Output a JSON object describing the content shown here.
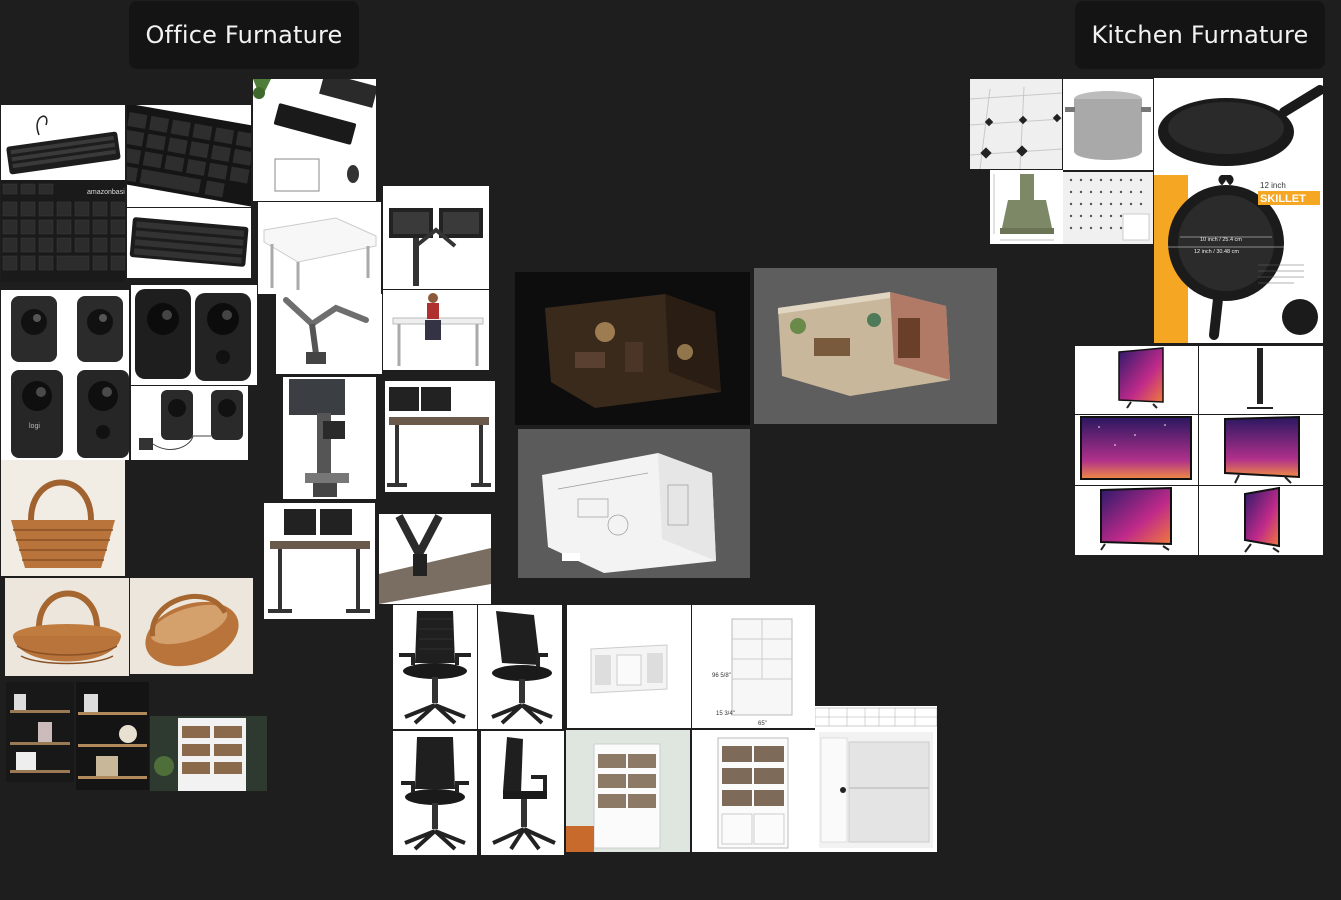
{
  "board": {
    "groups": [
      {
        "title": "Office Furnature"
      },
      {
        "title": "Kitchen Furnature"
      }
    ]
  },
  "tiles": {
    "keyboard_brand": "amazonbasics",
    "speaker_brand": "logi",
    "skillet": {
      "size_label": "12 inch",
      "name": "SKILLET",
      "dim_inner": "10 inch / 25.4 cm",
      "dim_outer": "12 inch / 30.48 cm"
    },
    "cabinet_dims": {
      "height": "96 5/8\"",
      "width": "65\"",
      "depth": "15 3/4\""
    }
  },
  "colors": {
    "background": "#1e1e1e",
    "label_bg": "#141414",
    "label_text": "#f2f2f2",
    "skillet_orange": "#f5a623"
  }
}
